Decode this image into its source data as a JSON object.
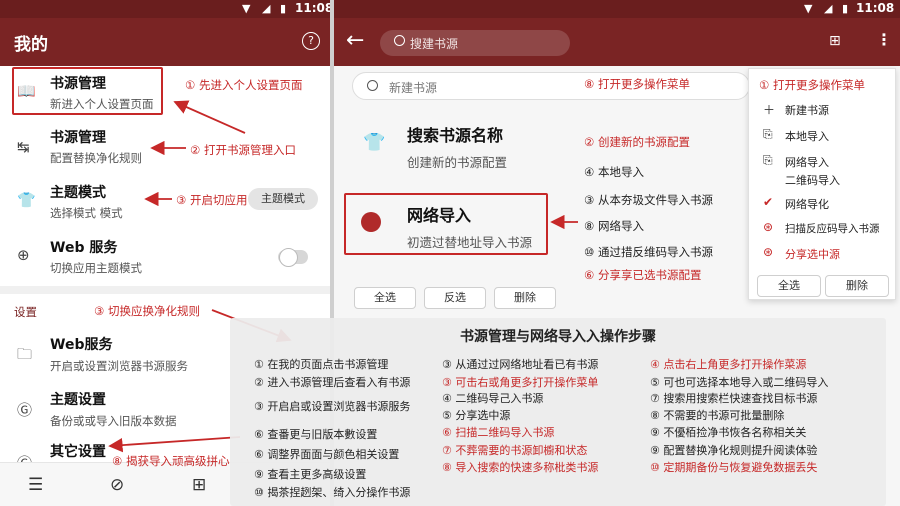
{
  "status_bar": {
    "time": "11:08"
  },
  "left_header": {
    "title": "我的",
    "help_icon": "help-circle-icon"
  },
  "right_header": {
    "search_placeholder": "搜建书源",
    "back_icon": "arrow-left-icon",
    "qr_icon": "qr-code-icon",
    "more_icon": "more-vert-icon"
  },
  "left_items": [
    {
      "title": "书源管理",
      "subtitle": "新进入个人设置页面",
      "icon": "book-icon"
    },
    {
      "title": "书源管理",
      "subtitle": "配置替换净化规则",
      "icon": "replace-icon"
    },
    {
      "title": "主题模式",
      "subtitle": "选择模式 模式",
      "icon": "shirt-icon",
      "chip": "主题模式"
    },
    {
      "title": "Web 服务",
      "subtitle": "切换应用主题模式",
      "icon": "web-icon"
    }
  ],
  "settings_section": {
    "label": "设置"
  },
  "settings_items": [
    {
      "title": "Web服务",
      "subtitle": "开启或设置浏览器书源服务",
      "icon": "folder-icon"
    },
    {
      "title": "主题设置",
      "subtitle": "备份或或导入旧版本数据",
      "icon": "backup-icon"
    },
    {
      "title": "其它设置",
      "subtitle": "",
      "icon": "settings-icon"
    }
  ],
  "bottom_nav": [
    "bookshelf-icon",
    "discover-icon",
    "bookmark-add-icon"
  ],
  "right_search_placeholder": "新建书源",
  "right_menu": [
    {
      "title": "搜索书源名称",
      "subtitle": "创建新的书源配置",
      "icon": "shirt-icon"
    },
    {
      "title": "网络导入",
      "subtitle": "初遗过替地址导入书源",
      "icon": "globe-icon"
    }
  ],
  "action_buttons": [
    "全选",
    "反选",
    "删除"
  ],
  "popup": {
    "header": "① 打开更多操作菜单",
    "items": [
      {
        "label": "新建书源",
        "icon": "plus-icon"
      },
      {
        "label": "本地导入",
        "icon": "import-icon"
      },
      {
        "label": "网络导入",
        "icon": "import-icon"
      },
      {
        "label": "二维码导入",
        "icon": ""
      },
      {
        "label": "网络导化",
        "icon": "network-icon"
      },
      {
        "label": "扫描反应码导入书源",
        "icon": "scan-icon"
      },
      {
        "label": "分享选中源",
        "icon": "share-icon"
      }
    ],
    "buttons": [
      "全选",
      "删除"
    ]
  },
  "annotations_left": [
    "① 先进入个人设置页面",
    "② 打开书源管理入口",
    "③ 开启切应用",
    "③ 切换应换净化规则",
    "⑧ 揭获导入顽高级拼心"
  ],
  "annotations_right": [
    "⑧ 打开更多操作菜单",
    "② 创建新的书源配置",
    "④ 本地导入",
    "③ 从本夯圾文件导入书源",
    "⑧ 网络导入",
    "⑩ 通过措反维码导入书源",
    "⑥ 分享享已选书源配置"
  ],
  "overlay": {
    "title": "书源管理与网络导入入操作步骤",
    "col1": [
      {
        "text": "① 在我的页面点击书源管理",
        "red": false
      },
      {
        "text": "② 进入书源管理后查看入有书源",
        "red": false
      },
      {
        "text": "③ 开启启或设置浏览器书源服务",
        "red": false
      },
      {
        "text": "⑥ 查番更与旧版本數设置",
        "red": false
      },
      {
        "text": "⑥ 调整界面面与颜色相关设置",
        "red": false
      },
      {
        "text": "⑨ 查看主更多高级设置",
        "red": false
      },
      {
        "text": "⑩ 揭茶捏趔架、绮入分操作书源",
        "red": false
      }
    ],
    "col2": [
      {
        "text": "③ 从通过过网络地址看已有书源",
        "red": false
      },
      {
        "text": "③ 可击右或角更多打开操作菜单",
        "red": true
      },
      {
        "text": "④ 二维码导己入书源",
        "red": false
      },
      {
        "text": "⑤ 分享选中源",
        "red": false
      },
      {
        "text": "⑥ 扫描二维码导入书源",
        "red": true
      },
      {
        "text": "⑦ 不葬需要的书源卸櫥和状态",
        "red": true
      },
      {
        "text": "⑧ 导入搜索的快速多称枇类书源",
        "red": true
      }
    ],
    "col3": [
      {
        "text": "④ 点击右上角更多打开操作菜源",
        "red": true
      },
      {
        "text": "⑤ 可也可选择本地导入或二维码导入",
        "red": false
      },
      {
        "text": "⑦ 搜索用搜索栏快速查找目标书源",
        "red": false
      },
      {
        "text": "⑧ 不需要的书源可批量删除",
        "red": false
      },
      {
        "text": "⑨ 不優栢捡净书恢各名称相关关",
        "red": false
      },
      {
        "text": "⑨ 配置替换净化规则提升阅读体验",
        "red": false
      },
      {
        "text": "⑩ 定期期备份与恢复避免数据丢失",
        "red": true
      }
    ]
  },
  "colors": {
    "header": "#7a2424",
    "accent": "#c62828"
  }
}
